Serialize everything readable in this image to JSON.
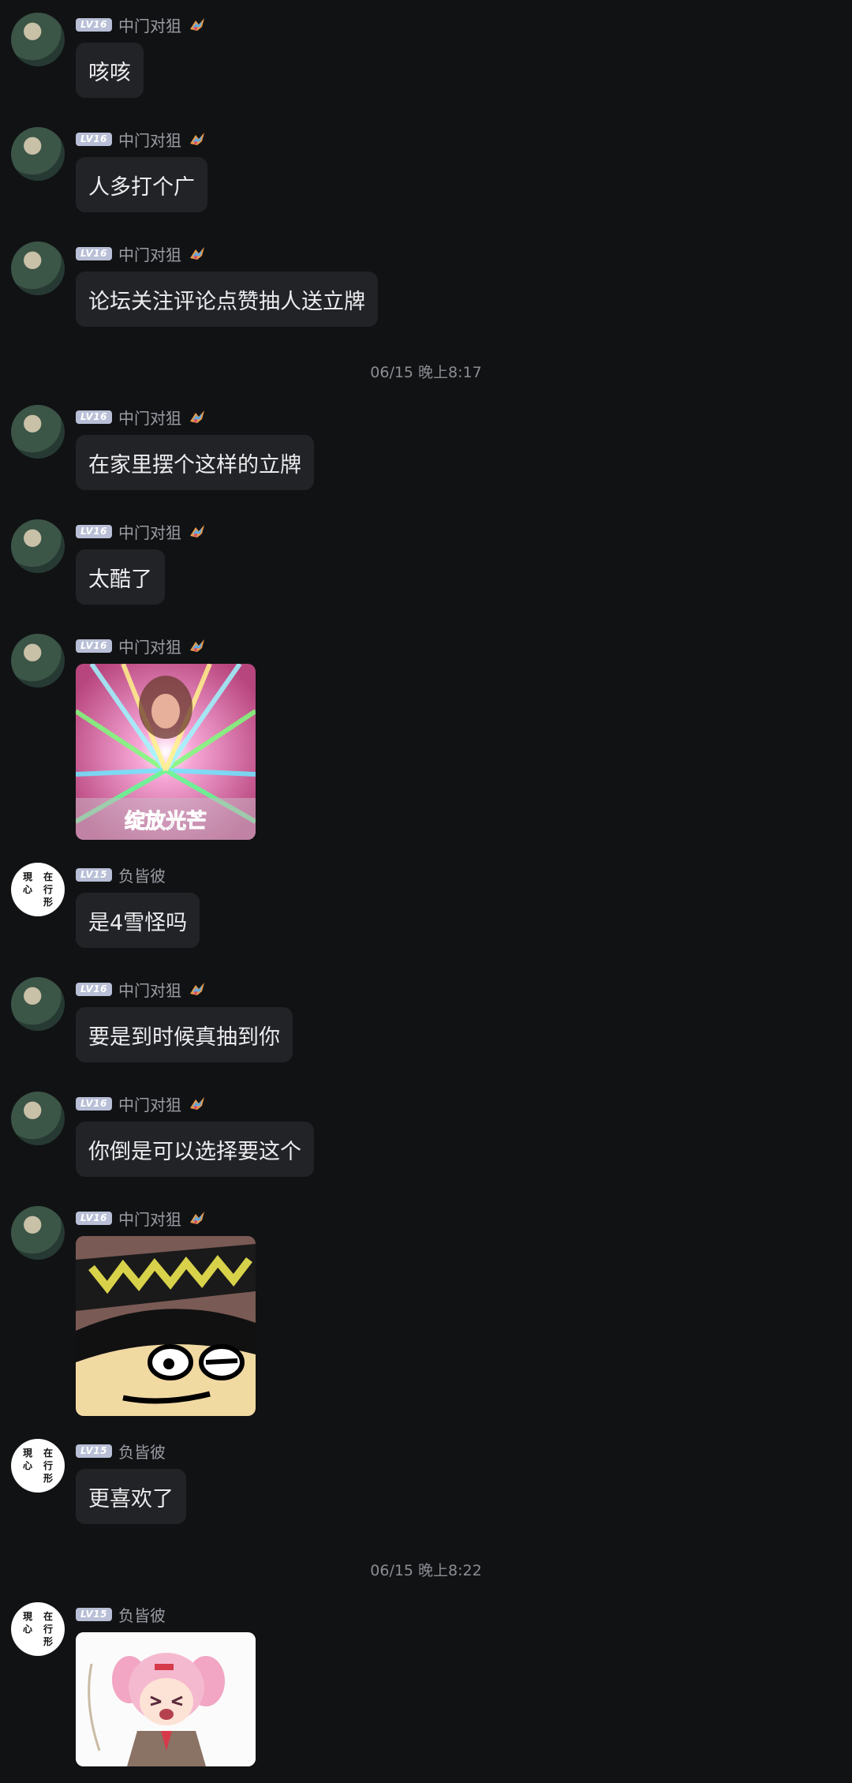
{
  "users": {
    "a": {
      "level": "LV16",
      "name": "中门对狙"
    },
    "b": {
      "level": "LV15",
      "name": "负皆彼",
      "seal_text": "現在心行形"
    }
  },
  "messages": [
    {
      "user": "a",
      "text": "咳咳"
    },
    {
      "user": "a",
      "text": "人多打个广"
    },
    {
      "user": "a",
      "text": "论坛关注评论点赞抽人送立牌"
    },
    {
      "user": "a",
      "text": "在家里摆个这样的立牌"
    },
    {
      "user": "a",
      "text": "太酷了"
    },
    {
      "user": "a",
      "image": "sticker-glow",
      "caption": "绽放光芒"
    },
    {
      "user": "b",
      "text": "是4雪怪吗"
    },
    {
      "user": "a",
      "text": "要是到时候真抽到你"
    },
    {
      "user": "a",
      "text": "你倒是可以选择要这个"
    },
    {
      "user": "a",
      "image": "sticker-cartoon-face"
    },
    {
      "user": "b",
      "text": "更喜欢了"
    },
    {
      "user": "b",
      "image": "sticker-anime-girl-crying"
    }
  ],
  "timestamps": [
    "06/15 晚上8:17",
    "06/15 晚上8:22"
  ],
  "colors": {
    "background": "#111214",
    "bubble": "#222327",
    "level_badge": "#b8bfd6",
    "name": "#9a9ca3"
  }
}
